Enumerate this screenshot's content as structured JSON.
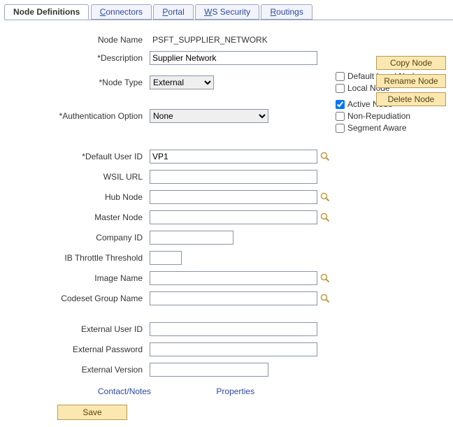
{
  "tabs": {
    "node_definitions": {
      "label": "Node Definitions",
      "mnemonic_index": 0
    },
    "connectors": {
      "label": "Connectors",
      "mnemonic_index": 0
    },
    "portal": {
      "label": "Portal",
      "mnemonic_index": 0
    },
    "ws_security": {
      "label": "WS Security",
      "mnemonic_index": 0
    },
    "routings": {
      "label": "Routings",
      "mnemonic_index": 0
    }
  },
  "side_buttons": {
    "copy": "Copy Node",
    "rename": "Rename Node",
    "delete": "Delete Node"
  },
  "labels": {
    "node_name": "Node Name",
    "description": "*Description",
    "node_type": "*Node Type",
    "authentication_option": "*Authentication Option",
    "default_user_id": "*Default User ID",
    "wsil_url": "WSIL URL",
    "hub_node": "Hub Node",
    "master_node": "Master Node",
    "company_id": "Company ID",
    "ib_throttle_threshold": "IB Throttle Threshold",
    "image_name": "Image Name",
    "codeset_group_name": "Codeset Group Name",
    "external_user_id": "External User ID",
    "external_password": "External Password",
    "external_version": "External Version"
  },
  "checkbox_labels": {
    "default_local_node": "Default Local Node",
    "local_node": "Local Node",
    "active_node": "Active Node",
    "non_repudiation": "Non-Repudiation",
    "segment_aware": "Segment Aware"
  },
  "values": {
    "node_name": "PSFT_SUPPLIER_NETWORK",
    "description": "Supplier Network",
    "node_type": "External",
    "authentication_option": "None",
    "default_user_id": "VP1",
    "wsil_url": "",
    "hub_node": "",
    "master_node": "",
    "company_id": "",
    "ib_throttle_threshold": "",
    "image_name": "",
    "codeset_group_name": "",
    "external_user_id": "",
    "external_password": "",
    "external_version": ""
  },
  "checkbox_states": {
    "default_local_node": false,
    "local_node": false,
    "active_node": true,
    "non_repudiation": false,
    "segment_aware": false
  },
  "links": {
    "contact_notes": "Contact/Notes",
    "properties": "Properties"
  },
  "save_button": "Save"
}
